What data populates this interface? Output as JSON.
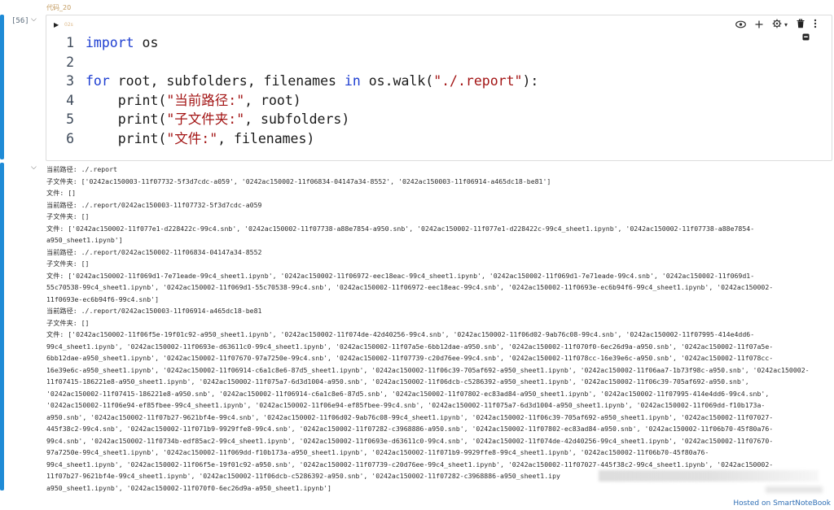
{
  "cell": {
    "title": "代码_20",
    "exec_count": "[56]",
    "collapse_icon": "chevron-down",
    "run_time": "02s",
    "toolbar": [
      "eye-icon",
      "plus-icon",
      "gear-icon",
      "chevron-down-icon",
      "trash-icon",
      "more-icon"
    ],
    "lines": [
      {
        "n": "1",
        "segs": [
          {
            "t": "import",
            "c": "kw"
          },
          {
            "t": " os",
            "c": ""
          }
        ]
      },
      {
        "n": "2",
        "segs": []
      },
      {
        "n": "3",
        "segs": [
          {
            "t": "for",
            "c": "kw"
          },
          {
            "t": " root, subfolders, filenames ",
            "c": ""
          },
          {
            "t": "in",
            "c": "kw"
          },
          {
            "t": " os.walk(",
            "c": ""
          },
          {
            "t": "\"./.report\"",
            "c": "str"
          },
          {
            "t": "):",
            "c": ""
          }
        ]
      },
      {
        "n": "4",
        "segs": [
          {
            "t": "    print(",
            "c": ""
          },
          {
            "t": "\"当前路径:\"",
            "c": "str"
          },
          {
            "t": ", root)",
            "c": ""
          }
        ]
      },
      {
        "n": "5",
        "segs": [
          {
            "t": "    print(",
            "c": ""
          },
          {
            "t": "\"子文件夹:\"",
            "c": "str"
          },
          {
            "t": ", subfolders)",
            "c": ""
          }
        ]
      },
      {
        "n": "6",
        "segs": [
          {
            "t": "    print(",
            "c": ""
          },
          {
            "t": "\"文件:\"",
            "c": "str"
          },
          {
            "t": ", filenames)",
            "c": ""
          }
        ]
      }
    ]
  },
  "output": {
    "lines": [
      "当前路径: ./.report",
      "子文件夹: ['0242ac150003-11f07732-5f3d7cdc-a059', '0242ac150002-11f06834-04147a34-8552', '0242ac150003-11f06914-a465dc18-be81']",
      "文件: []",
      "当前路径: ./.report/0242ac150003-11f07732-5f3d7cdc-a059",
      "子文件夹: []",
      "文件: ['0242ac150002-11f077e1-d228422c-99c4.snb', '0242ac150002-11f07738-a88e7854-a950.snb', '0242ac150002-11f077e1-d228422c-99c4_sheet1.ipynb', '0242ac150002-11f07738-a88e7854-",
      "a950_sheet1.ipynb']",
      "当前路径: ./.report/0242ac150002-11f06834-04147a34-8552",
      "子文件夹: []",
      "文件: ['0242ac150002-11f069d1-7e71eade-99c4_sheet1.ipynb', '0242ac150002-11f06972-eec18eac-99c4_sheet1.ipynb', '0242ac150002-11f069d1-7e71eade-99c4.snb', '0242ac150002-11f069d1-",
      "55c70538-99c4_sheet1.ipynb', '0242ac150002-11f069d1-55c70538-99c4.snb', '0242ac150002-11f06972-eec18eac-99c4.snb', '0242ac150002-11f0693e-ec6b94f6-99c4_sheet1.ipynb', '0242ac150002-",
      "11f0693e-ec6b94f6-99c4.snb']",
      "当前路径: ./.report/0242ac150003-11f06914-a465dc18-be81",
      "子文件夹: []",
      "文件: ['0242ac150002-11f06f5e-19f01c92-a950_sheet1.ipynb', '0242ac150002-11f074de-42d40256-99c4.snb', '0242ac150002-11f06d02-9ab76c08-99c4.snb', '0242ac150002-11f07995-414e4dd6-",
      "99c4_sheet1.ipynb', '0242ac150002-11f0693e-d63611c0-99c4_sheet1.ipynb', '0242ac150002-11f07a5e-6bb12dae-a950.snb', '0242ac150002-11f070f0-6ec26d9a-a950.snb', '0242ac150002-11f07a5e-",
      "6bb12dae-a950_sheet1.ipynb', '0242ac150002-11f07670-97a7250e-99c4.snb', '0242ac150002-11f07739-c20d76ee-99c4.snb', '0242ac150002-11f078cc-16e39e6c-a950.snb', '0242ac150002-11f078cc-",
      "16e39e6c-a950_sheet1.ipynb', '0242ac150002-11f06914-c6a1c8e6-87d5_sheet1.ipynb', '0242ac150002-11f06c39-705af692-a950_sheet1.ipynb', '0242ac150002-11f06aa7-1b73f98c-a950.snb', '0242ac150002-",
      "11f07415-186221e8-a950_sheet1.ipynb', '0242ac150002-11f075a7-6d3d1004-a950.snb', '0242ac150002-11f06dcb-c5286392-a950_sheet1.ipynb', '0242ac150002-11f06c39-705af692-a950.snb',",
      "'0242ac150002-11f07415-186221e8-a950.snb', '0242ac150002-11f06914-c6a1c8e6-87d5.snb', '0242ac150002-11f07802-ec83ad84-a950_sheet1.ipynb', '0242ac150002-11f07995-414e4dd6-99c4.snb',",
      "'0242ac150002-11f06e94-ef85fbee-99c4_sheet1.ipynb', '0242ac150002-11f06e94-ef85fbee-99c4.snb', '0242ac150002-11f075a7-6d3d1004-a950_sheet1.ipynb', '0242ac150002-11f069dd-f10b173a-",
      "a950.snb', '0242ac150002-11f07b27-9621bf4e-99c4.snb', '0242ac150002-11f06d02-9ab76c08-99c4_sheet1.ipynb', '0242ac150002-11f06c39-705af692-a950_sheet1.ipynb', '0242ac150002-11f07027-",
      "445f38c2-99c4.snb', '0242ac150002-11f071b9-9929ffe8-99c4.snb', '0242ac150002-11f07282-c3968886-a950.snb', '0242ac150002-11f07802-ec83ad84-a950.snb', '0242ac150002-11f06b70-45f80a76-",
      "99c4.snb', '0242ac150002-11f0734b-edf85ac2-99c4_sheet1.ipynb', '0242ac150002-11f0693e-d63611c0-99c4.snb', '0242ac150002-11f074de-42d40256-99c4_sheet1.ipynb', '0242ac150002-11f07670-",
      "97a7250e-99c4_sheet1.ipynb', '0242ac150002-11f069dd-f10b173a-a950_sheet1.ipynb', '0242ac150002-11f071b9-9929ffe8-99c4_sheet1.ipynb', '0242ac150002-11f06b70-45f80a76-",
      "99c4_sheet1.ipynb', '0242ac150002-11f06f5e-19f01c92-a950.snb', '0242ac150002-11f07739-c20d76ee-99c4_sheet1.ipynb', '0242ac150002-11f07027-445f38c2-99c4_sheet1.ipynb', '0242ac150002-",
      "11f07b27-9621bf4e-99c4_sheet1.ipynb', '0242ac150002-11f06dcb-c5286392-a950.snb', '0242ac150002-11f07282-c3968886-a950_sheet1.ipy",
      "a950_sheet1.ipynb', '0242ac150002-11f070f0-6ec26d9a-a950_sheet1.ipynb']"
    ]
  },
  "footer": "Hosted on SmartNoteBook"
}
